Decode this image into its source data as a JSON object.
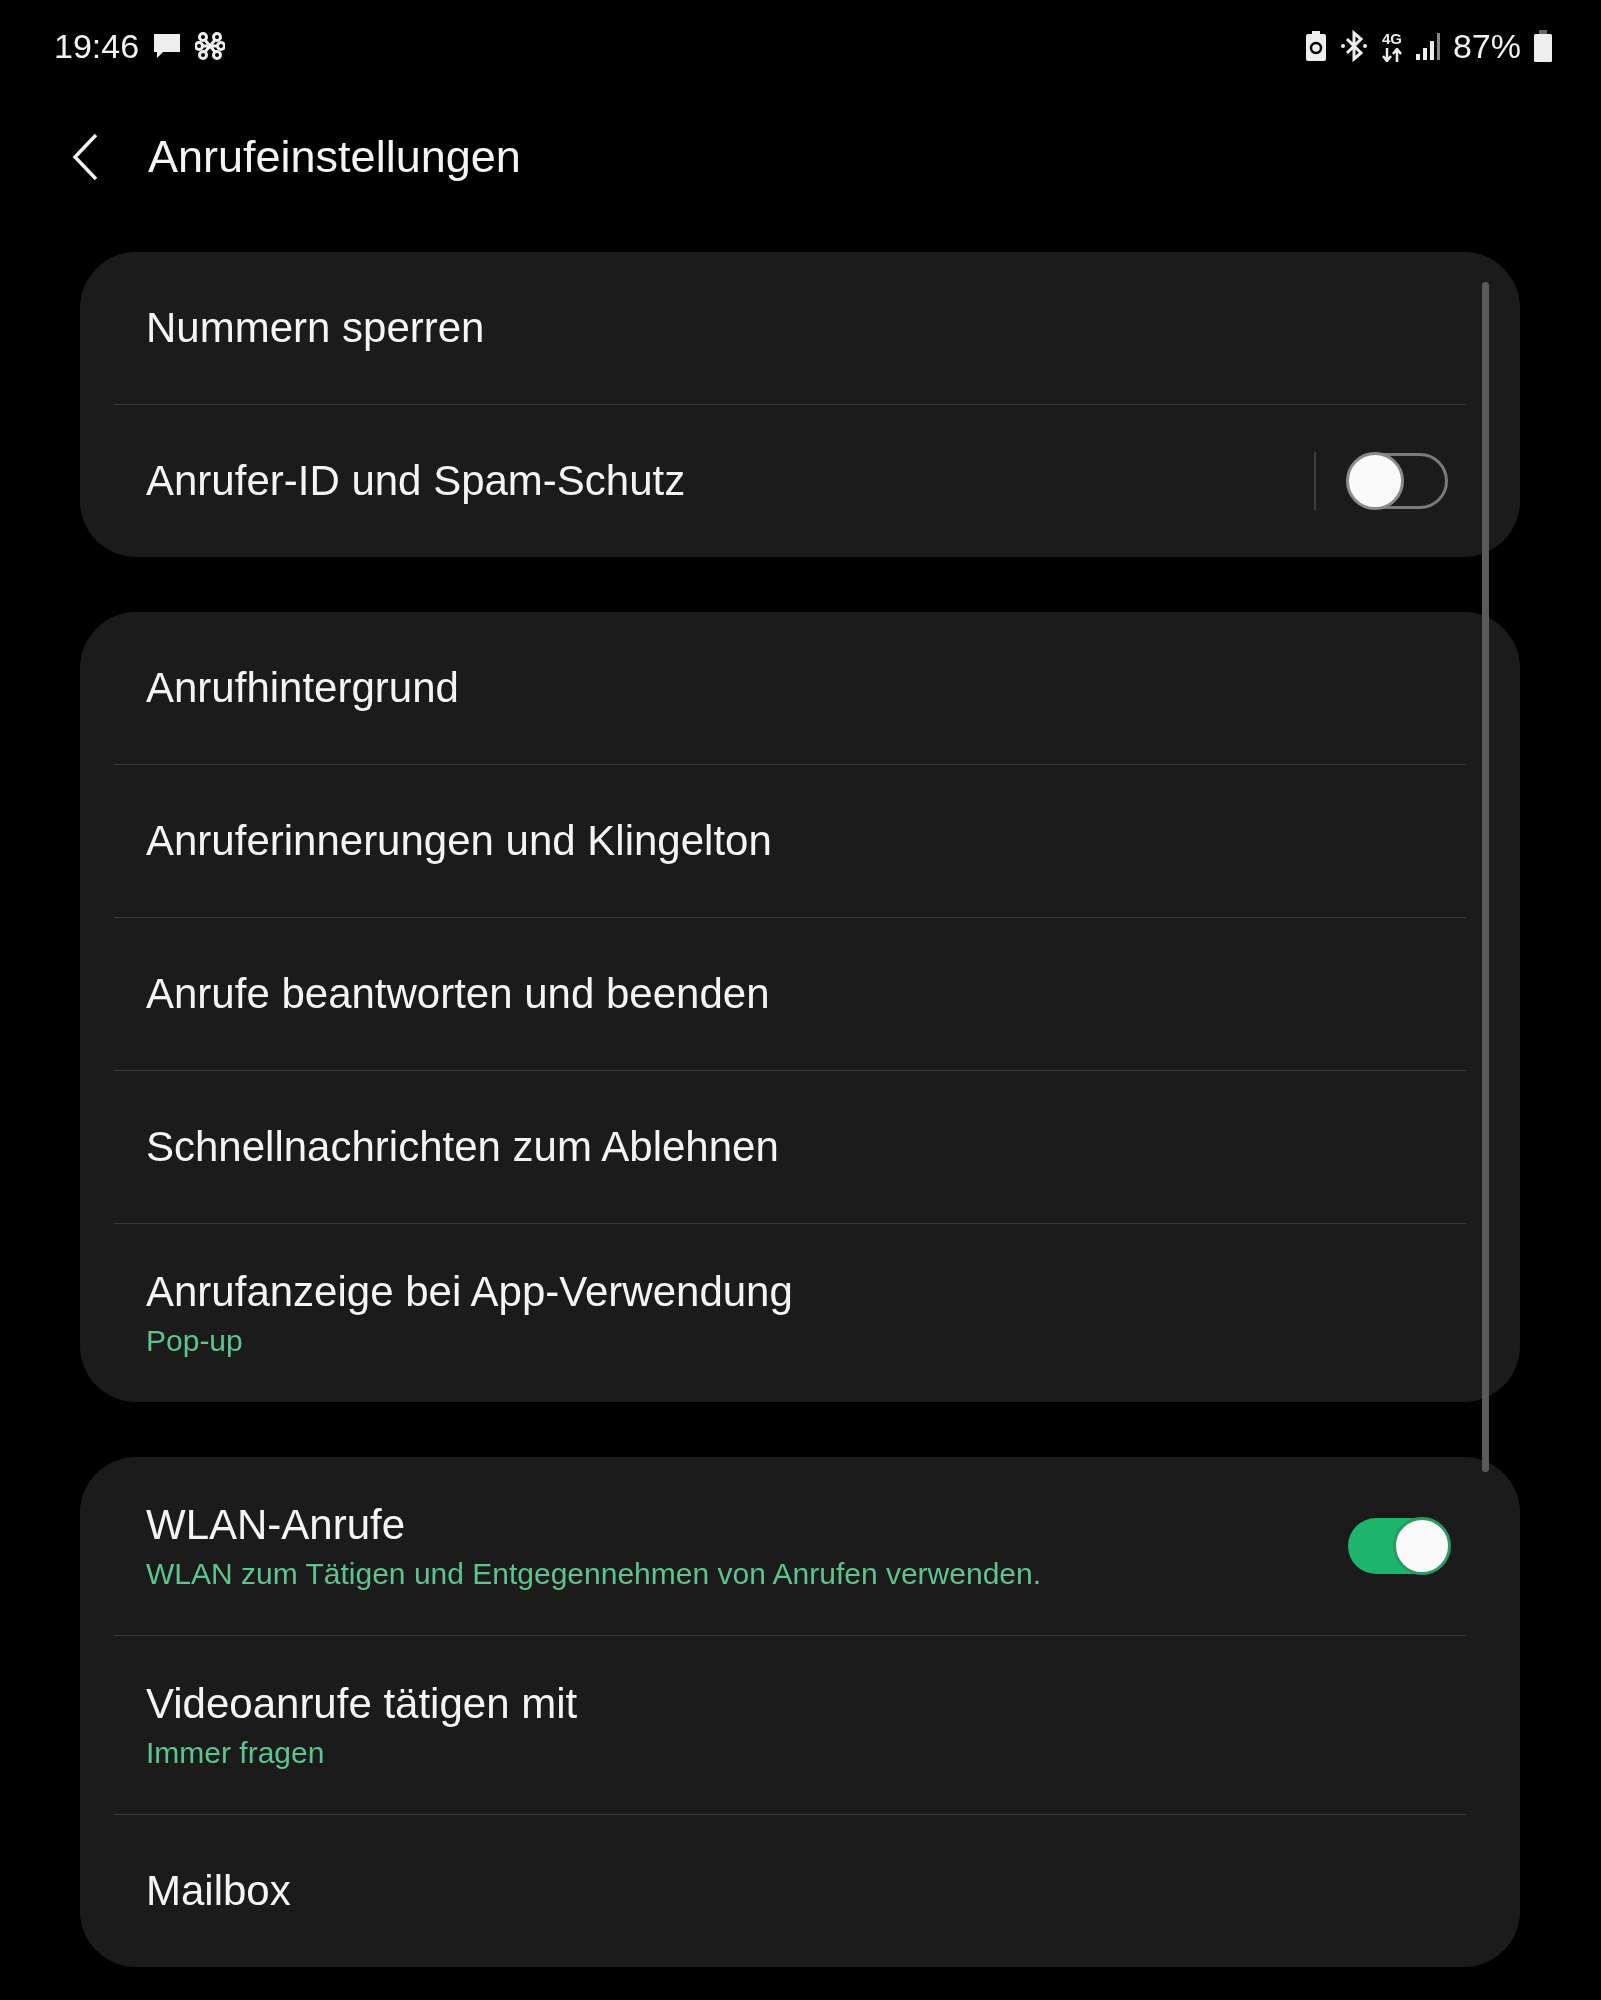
{
  "status_bar": {
    "time": "19:46",
    "network_type": "4G",
    "battery": "87%"
  },
  "header": {
    "title": "Anrufeinstellungen"
  },
  "groups": [
    {
      "items": [
        {
          "kind": "link",
          "label": "Nummern sperren"
        },
        {
          "kind": "link_switch",
          "label": "Anrufer-ID und Spam-Schutz",
          "on": false
        }
      ]
    },
    {
      "items": [
        {
          "kind": "link",
          "label": "Anrufhintergrund"
        },
        {
          "kind": "link",
          "label": "Anruferinnerungen und Klingelton"
        },
        {
          "kind": "link",
          "label": "Anrufe beantworten und beenden"
        },
        {
          "kind": "link",
          "label": "Schnellnachrichten zum Ablehnen"
        },
        {
          "kind": "link",
          "label": "Anrufanzeige bei App-Verwendung",
          "sublabel": "Pop-up"
        }
      ]
    },
    {
      "items": [
        {
          "kind": "switch",
          "label": "WLAN-Anrufe",
          "sublabel": "WLAN zum Tätigen und Entgegennehmen von Anrufen verwenden.",
          "on": true
        },
        {
          "kind": "link",
          "label": "Videoanrufe tätigen mit",
          "sublabel": "Immer fragen"
        },
        {
          "kind": "link",
          "label": "Mailbox"
        }
      ]
    }
  ]
}
